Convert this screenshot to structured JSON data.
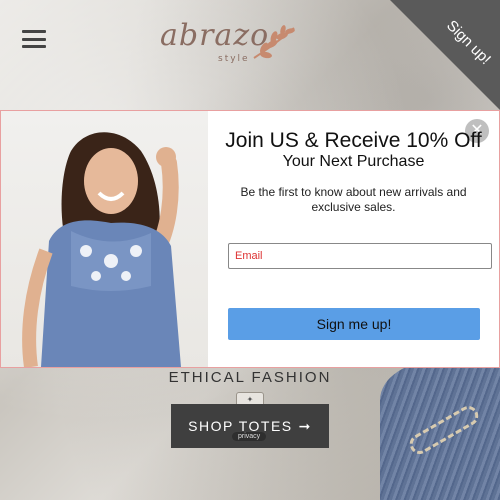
{
  "header": {
    "menu_icon": "hamburger-menu-icon",
    "logo": {
      "text": "abrazo",
      "sub": "style"
    },
    "corner_signup_label": "Sign up!"
  },
  "popup": {
    "headline": "Join US & Receive 10% Off",
    "subheadline": "Your Next Purchase",
    "description": "Be the first to know about new arrivals and exclusive sales.",
    "email_placeholder": "Email",
    "submit_label": "Sign me up!",
    "close_icon": "close-icon",
    "accent_color": "#5a9ee6"
  },
  "hero": {
    "tagline": "ETHICAL FASHION",
    "cta_label": "SHOP TOTES",
    "cta_arrow": "➞",
    "privacy_label": "privacy"
  }
}
